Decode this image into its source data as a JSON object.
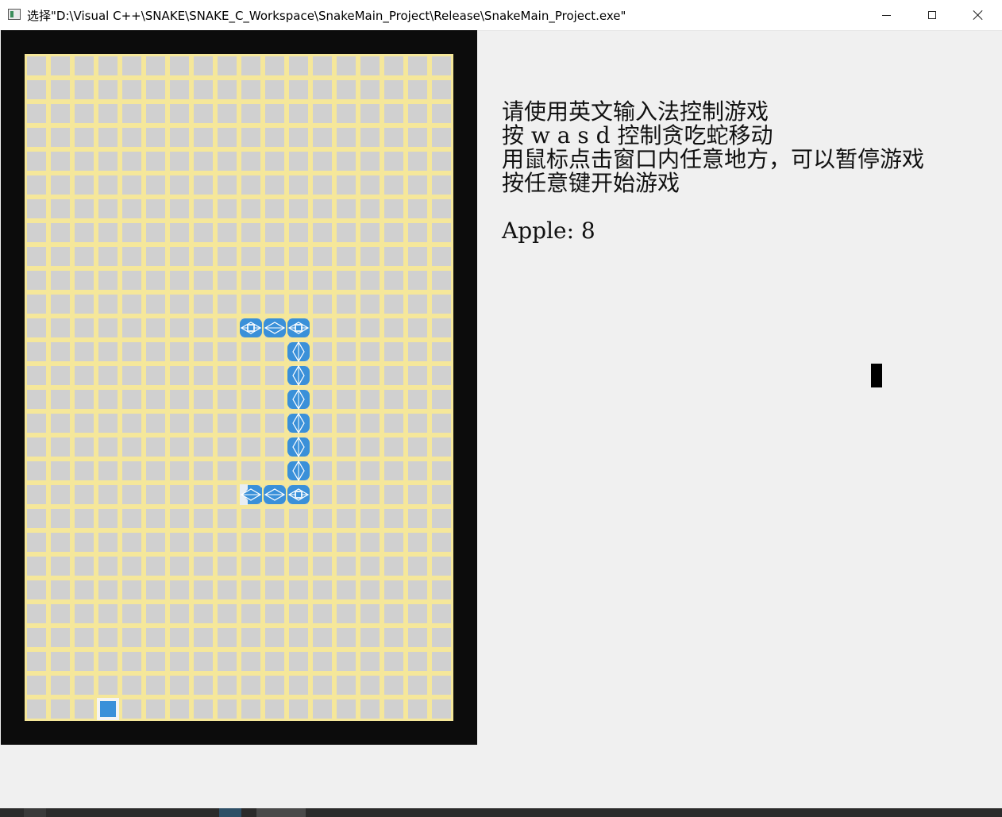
{
  "window": {
    "title": "选择\"D:\\Visual C++\\SNAKE\\SNAKE_C_Workspace\\SnakeMain_Project\\Release\\SnakeMain_Project.exe\"",
    "controls": {
      "minimize_icon": "minimize-icon",
      "maximize_icon": "maximize-icon",
      "close_icon": "close-icon"
    }
  },
  "colors": {
    "board_background": "#0c0c0c",
    "grid_line": "#f5e79a",
    "cell": "#d0d0d0",
    "snake": "#3a90d9",
    "apple": "#3a90d9",
    "panel_background": "#f0f0f0"
  },
  "board": {
    "columns": 18,
    "rows": 28,
    "snake": [
      {
        "col": 9,
        "row": 18,
        "part": "tail"
      },
      {
        "col": 10,
        "row": 18,
        "part": "body"
      },
      {
        "col": 11,
        "row": 18,
        "part": "corner"
      },
      {
        "col": 11,
        "row": 17,
        "part": "body"
      },
      {
        "col": 11,
        "row": 16,
        "part": "body"
      },
      {
        "col": 11,
        "row": 15,
        "part": "body"
      },
      {
        "col": 11,
        "row": 14,
        "part": "body"
      },
      {
        "col": 11,
        "row": 13,
        "part": "body"
      },
      {
        "col": 11,
        "row": 12,
        "part": "body"
      },
      {
        "col": 11,
        "row": 11,
        "part": "corner"
      },
      {
        "col": 10,
        "row": 11,
        "part": "body"
      },
      {
        "col": 9,
        "row": 11,
        "part": "head"
      }
    ],
    "apple": {
      "col": 3,
      "row": 27
    }
  },
  "info": {
    "line1": "请使用英文输入法控制游戏",
    "line2": "按 w a s d 控制贪吃蛇移动",
    "line3": "用鼠标点击窗口内任意地方，可以暂停游戏",
    "line4": "按任意键开始游戏",
    "apple_label": "Apple: 8"
  }
}
